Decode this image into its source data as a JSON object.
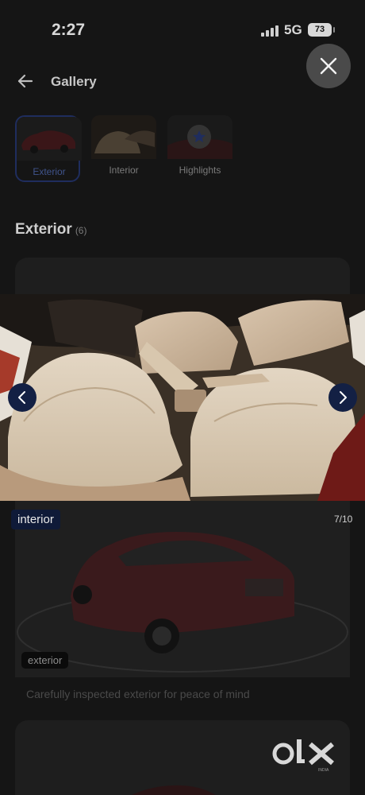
{
  "status_bar": {
    "time": "2:27",
    "network": "5G",
    "battery": "73"
  },
  "header": {
    "title": "Gallery"
  },
  "categories": [
    {
      "label": "Exterior",
      "active": true
    },
    {
      "label": "Interior",
      "active": false
    },
    {
      "label": "Highlights",
      "active": false
    }
  ],
  "section": {
    "title": "Exterior",
    "count": "(6)"
  },
  "viewer": {
    "tag": "interior",
    "counter": "7/10"
  },
  "card": {
    "tag": "exterior",
    "caption": "Carefully inspected exterior for peace of mind"
  },
  "brand": {
    "logo": "OLX",
    "sub": "INDIA"
  },
  "colors": {
    "accent_navy": "#132044",
    "overlay": "#151515"
  }
}
